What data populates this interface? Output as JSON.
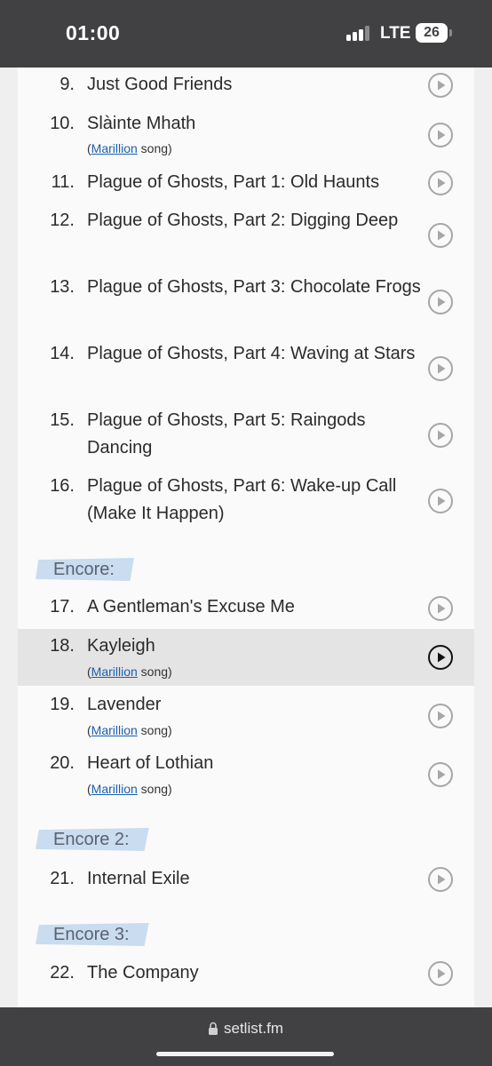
{
  "status_bar": {
    "time": "01:00",
    "network": "LTE",
    "battery": "26"
  },
  "sections": [
    {
      "label": "Encore:"
    },
    {
      "label": "Encore 2:"
    },
    {
      "label": "Encore 3:"
    }
  ],
  "songs": [
    {
      "number": "9.",
      "title": "Just Good Friends"
    },
    {
      "number": "10.",
      "title": "Slàinte Mhath",
      "note_open": "(",
      "note_link": "Marillion",
      "note_close": " song)"
    },
    {
      "number": "11.",
      "title": "Plague of Ghosts, Part 1: Old Haunts"
    },
    {
      "number": "12.",
      "title": "Plague of Ghosts, Part 2: Digging Deep"
    },
    {
      "number": "13.",
      "title": "Plague of Ghosts, Part 3: Chocolate Frogs"
    },
    {
      "number": "14.",
      "title": "Plague of Ghosts, Part 4: Waving at Stars"
    },
    {
      "number": "15.",
      "title": "Plague of Ghosts, Part 5: Raingods Dancing"
    },
    {
      "number": "16.",
      "title": "Plague of Ghosts, Part 6: Wake-up Call (Make It Happen)"
    },
    {
      "number": "17.",
      "title": "A Gentleman's Excuse Me"
    },
    {
      "number": "18.",
      "title": "Kayleigh",
      "note_open": "(",
      "note_link": "Marillion",
      "note_close": " song)"
    },
    {
      "number": "19.",
      "title": "Lavender",
      "note_open": "(",
      "note_link": "Marillion",
      "note_close": " song)"
    },
    {
      "number": "20.",
      "title": "Heart of Lothian",
      "note_open": "(",
      "note_link": "Marillion",
      "note_close": " song)"
    },
    {
      "number": "21.",
      "title": "Internal Exile"
    },
    {
      "number": "22.",
      "title": "The Company"
    }
  ],
  "url_bar": {
    "domain": "setlist.fm"
  },
  "colors": {
    "chrome": "#414144",
    "page": "#fafafa",
    "highlight_row": "#e4e4e4",
    "link": "#1a5fb0",
    "section_marker": "#c9dcf0"
  }
}
